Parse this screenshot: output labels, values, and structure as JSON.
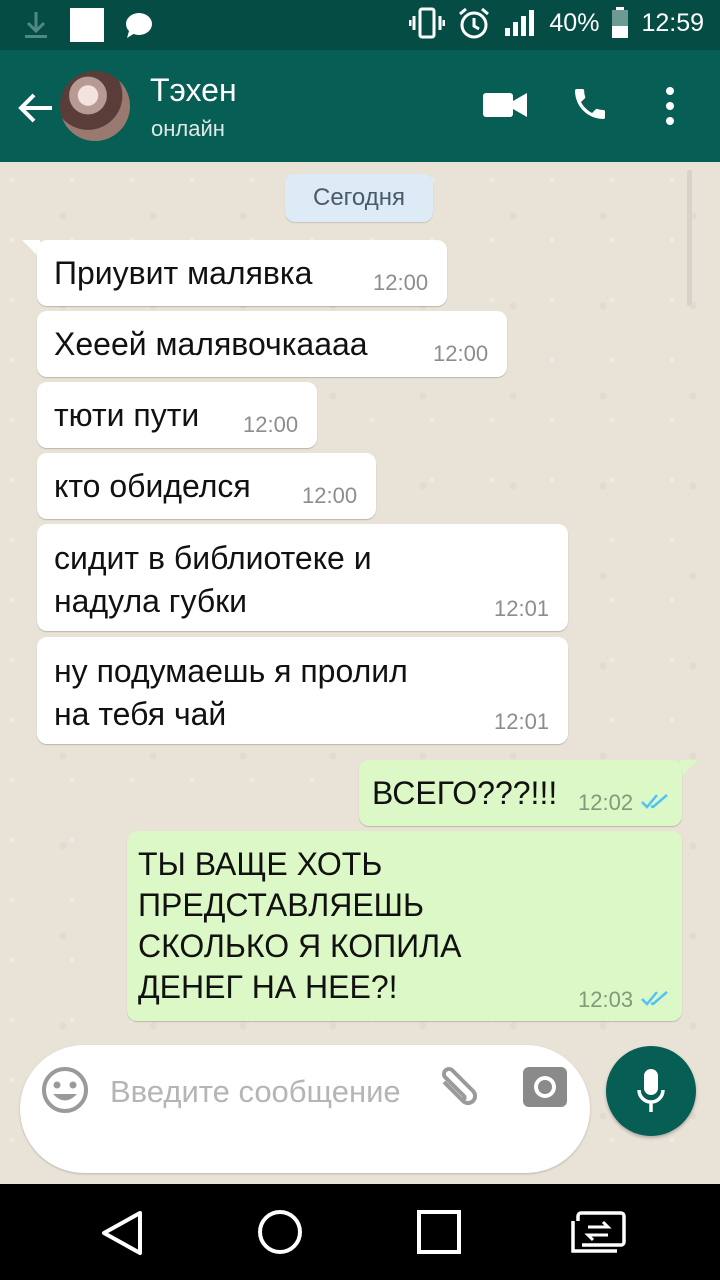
{
  "status_bar": {
    "battery": "40%",
    "time": "12:59",
    "icons": [
      "download-icon",
      "image-icon",
      "chat-icon",
      "vibrate-icon",
      "alarm-icon",
      "signal-icon",
      "battery-icon"
    ]
  },
  "header": {
    "contact_name": "Тэхен",
    "status": "онлайн",
    "icons": [
      "back-arrow-icon",
      "video-call-icon",
      "phone-icon",
      "more-vert-icon"
    ]
  },
  "chat": {
    "date_chip": "Сегодня",
    "messages": [
      {
        "dir": "in",
        "text": "Приувит малявка",
        "time": "12:00"
      },
      {
        "dir": "in",
        "text": "Хееей малявочкаааа",
        "time": "12:00"
      },
      {
        "dir": "in",
        "text": "тюти пути",
        "time": "12:00"
      },
      {
        "dir": "in",
        "text": "кто обиделся",
        "time": "12:00"
      },
      {
        "dir": "in",
        "text": "сидит в библиотеке и\nнадула губки",
        "time": "12:01"
      },
      {
        "dir": "in",
        "text": "ну подумаешь я пролил\nна тебя чай",
        "time": "12:01"
      },
      {
        "dir": "out",
        "text": "ВСЕГО???!!!",
        "time": "12:02",
        "status": "read"
      },
      {
        "dir": "out",
        "text": "ТЫ ВАЩЕ ХОТЬ\nПРЕДСТАВЛЯЕШЬ\nСКОЛЬКО Я КОПИЛА\nДЕНЕГ НА НЕЕ?!",
        "time": "12:03",
        "status": "read"
      }
    ]
  },
  "composer": {
    "placeholder": "Введите сообщение",
    "icons": [
      "emoji-icon",
      "attach-icon",
      "camera-icon",
      "mic-icon"
    ]
  },
  "nav": {
    "icons": [
      "nav-back-icon",
      "nav-home-icon",
      "nav-recents-icon",
      "nav-switch-icon"
    ]
  },
  "colors": {
    "header": "#075e54",
    "status_bar": "#054d44",
    "incoming_bubble": "#ffffff",
    "outgoing_bubble": "#dcf8c6",
    "read_ticks": "#4fc3f7"
  }
}
